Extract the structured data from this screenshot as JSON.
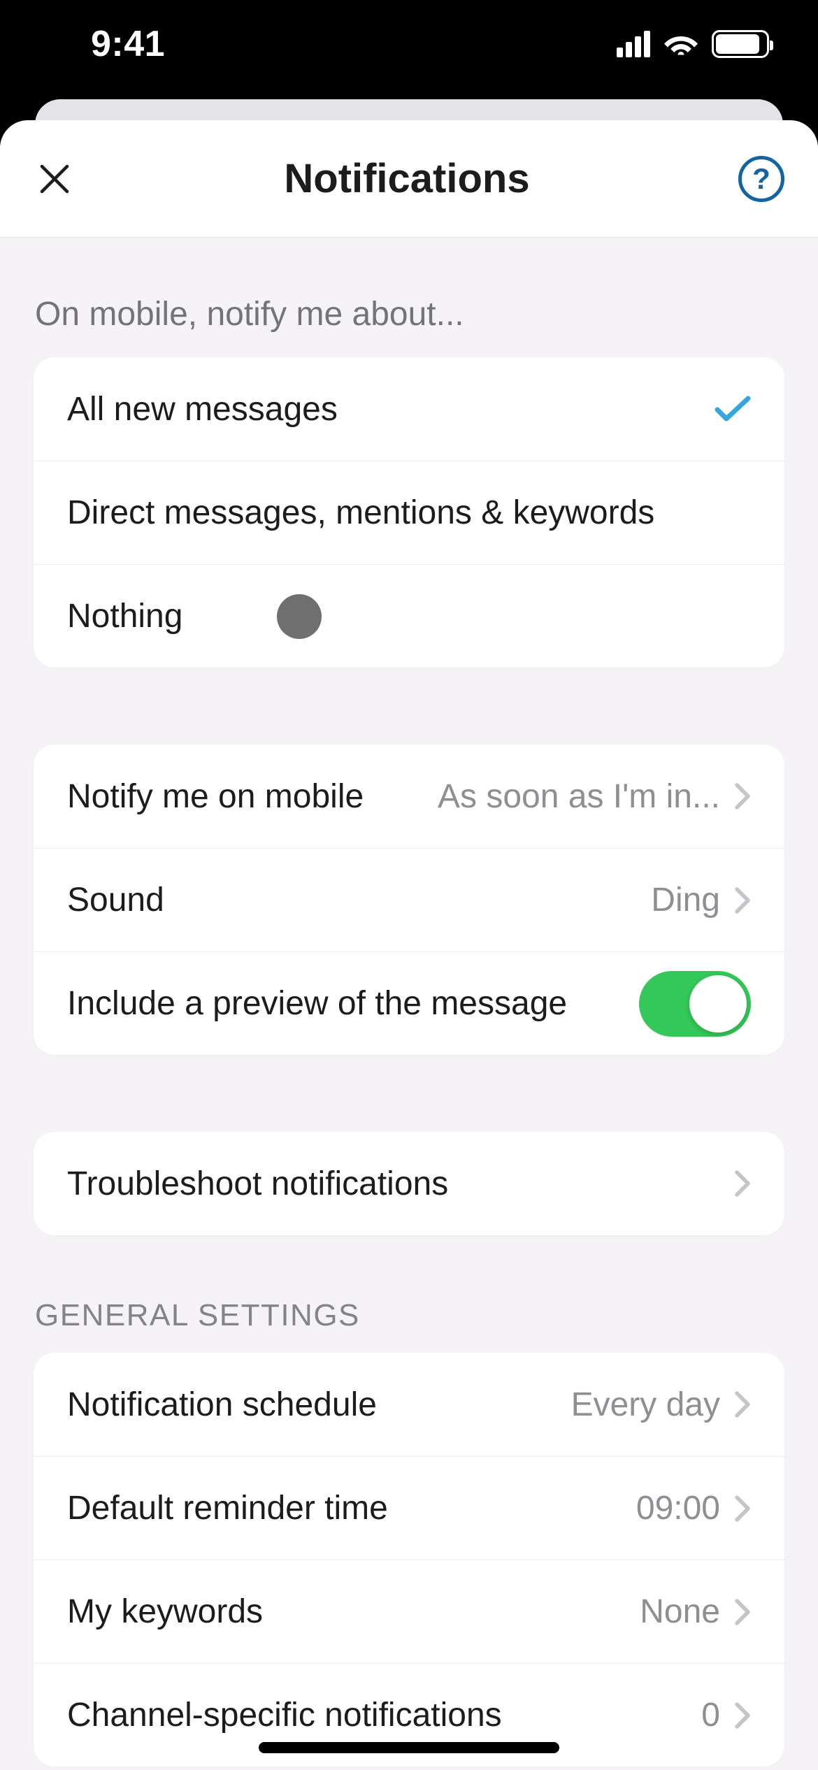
{
  "status": {
    "time": "9:41"
  },
  "nav": {
    "title": "Notifications",
    "help_label": "?"
  },
  "sections": {
    "notify_about": {
      "header": "On mobile, notify me about...",
      "option_all": "All new messages",
      "option_dm": "Direct messages, mentions & keywords",
      "option_nothing": "Nothing"
    },
    "prefs": {
      "timing_label": "Notify me on mobile",
      "timing_value": "As soon as I'm in...",
      "sound_label": "Sound",
      "sound_value": "Ding",
      "preview_label": "Include a preview of the message",
      "preview_on": true
    },
    "troubleshoot": {
      "label": "Troubleshoot notifications"
    },
    "general": {
      "header": "General Settings",
      "schedule_label": "Notification schedule",
      "schedule_value": "Every day",
      "reminder_label": "Default reminder time",
      "reminder_value": "09:00",
      "keywords_label": "My keywords",
      "keywords_value": "None",
      "channel_label": "Channel-specific notifications",
      "channel_value": "0"
    }
  },
  "colors": {
    "accent_blue": "#36a6e0",
    "link_blue": "#1264a3",
    "toggle_green": "#34c759"
  }
}
